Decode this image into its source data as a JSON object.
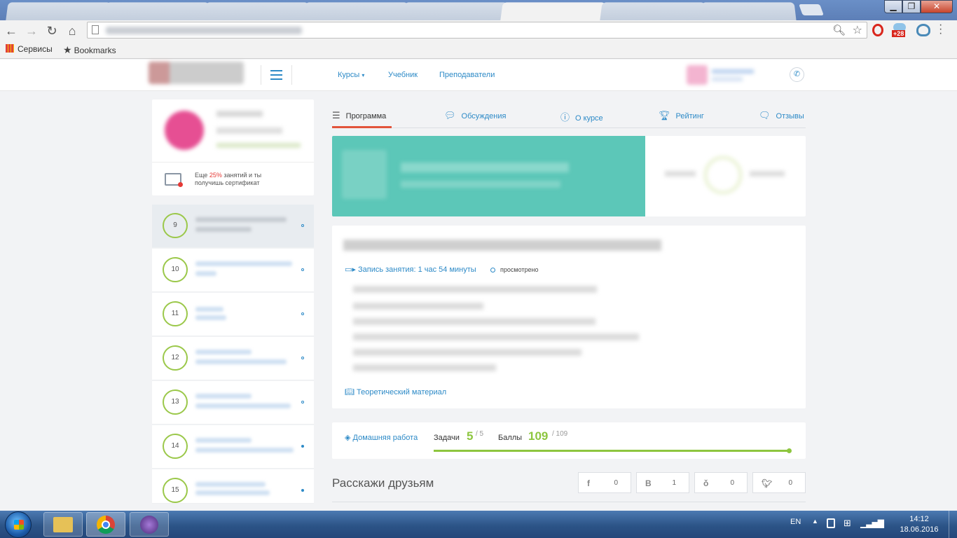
{
  "browser": {
    "bookmarks": [
      {
        "icon": "apps-grid-icon",
        "label": "Сервисы"
      },
      {
        "icon": "star-icon",
        "label": "Bookmarks"
      }
    ],
    "extension_badge": "+28"
  },
  "site_nav": {
    "courses": "Курсы",
    "textbook": "Учебник",
    "teachers": "Преподаватели"
  },
  "certificate": {
    "prefix": "Еще",
    "percent": "25%",
    "suffix_line1": "занятий и ты",
    "suffix_line2": "получишь сертификат"
  },
  "lessons": [
    {
      "number": "9",
      "active": true
    },
    {
      "number": "10"
    },
    {
      "number": "11"
    },
    {
      "number": "12"
    },
    {
      "number": "13"
    },
    {
      "number": "14"
    },
    {
      "number": "15"
    }
  ],
  "tabs": [
    {
      "icon": "list-icon",
      "label": "Программа",
      "active": true
    },
    {
      "icon": "chat-icon",
      "label": "Обсуждения"
    },
    {
      "icon": "info-icon",
      "label": "О курсе"
    },
    {
      "icon": "trophy-icon",
      "label": "Рейтинг"
    },
    {
      "icon": "comment-icon",
      "label": "Отзывы"
    }
  ],
  "lesson": {
    "recording": "Запись занятия: 1 час 54 минуты",
    "status": "просмотрено",
    "theory": "Теоретический материал"
  },
  "homework": {
    "label": "Домашняя работа",
    "tasks_label": "Задачи",
    "tasks_done": "5",
    "tasks_total": "/ 5",
    "points_label": "Баллы",
    "points_done": "109",
    "points_total": "/ 109",
    "progress": 1.0
  },
  "share": {
    "title": "Расскажи друзьям",
    "items": [
      {
        "network": "f",
        "count": "0"
      },
      {
        "network": "В",
        "count": "1"
      },
      {
        "network": "ok",
        "count": "0"
      },
      {
        "network": "tw",
        "count": "0"
      }
    ]
  },
  "taskbar": {
    "lang": "EN",
    "time": "14:12",
    "date": "18.06.2016"
  },
  "colors": {
    "accent_blue": "#2d8ac7",
    "green": "#8dc63f",
    "teal_banner": "#5cc7b8",
    "tab_underline": "#e2543b",
    "percent_red": "#e53935"
  }
}
